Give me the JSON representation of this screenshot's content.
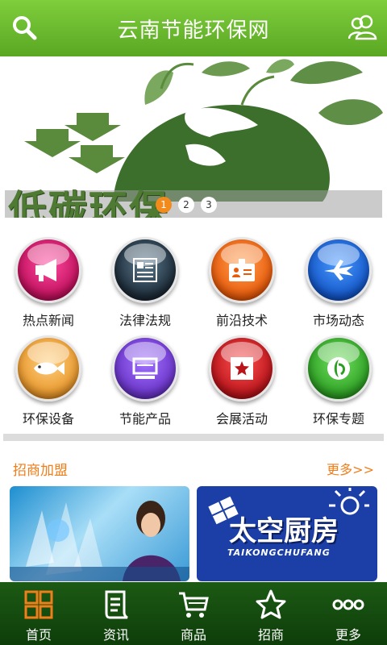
{
  "header": {
    "title": "云南节能环保网",
    "left_icon": "search-icon",
    "right_icon": "users-icon"
  },
  "banner": {
    "caption": "低碳环保",
    "pages": [
      "1",
      "2",
      "3"
    ],
    "active_page": 1
  },
  "categories": [
    {
      "label": "热点新闻",
      "icon": "megaphone-icon",
      "color": "#d0186a"
    },
    {
      "label": "法律法规",
      "icon": "document-icon",
      "color": "#1c2a36"
    },
    {
      "label": "前沿技术",
      "icon": "badge-icon",
      "color": "#e85a0a"
    },
    {
      "label": "市场动态",
      "icon": "plane-icon",
      "color": "#1356c8"
    },
    {
      "label": "环保设备",
      "icon": "fish-icon",
      "color": "#e8962a"
    },
    {
      "label": "节能产品",
      "icon": "monitor-icon",
      "color": "#6a34c8"
    },
    {
      "label": "会展活动",
      "icon": "star-icon",
      "color": "#b8141a"
    },
    {
      "label": "环保专题",
      "icon": "leaf-icon",
      "color": "#2c9e22"
    }
  ],
  "section": {
    "title": "招商加盟",
    "more": "更多>>"
  },
  "ads": {
    "second_title": "太空厨房",
    "second_subtitle": "TAIKONGCHUFANG"
  },
  "tabbar": [
    {
      "label": "首页",
      "icon": "grid-icon",
      "active": true
    },
    {
      "label": "资讯",
      "icon": "news-icon"
    },
    {
      "label": "商品",
      "icon": "cart-icon"
    },
    {
      "label": "招商",
      "icon": "star-outline-icon"
    },
    {
      "label": "更多",
      "icon": "more-dots-icon"
    }
  ],
  "colors": {
    "header_green": "#6cbf2f",
    "accent_orange": "#f07e1a",
    "tabbar_green": "#164d10"
  }
}
